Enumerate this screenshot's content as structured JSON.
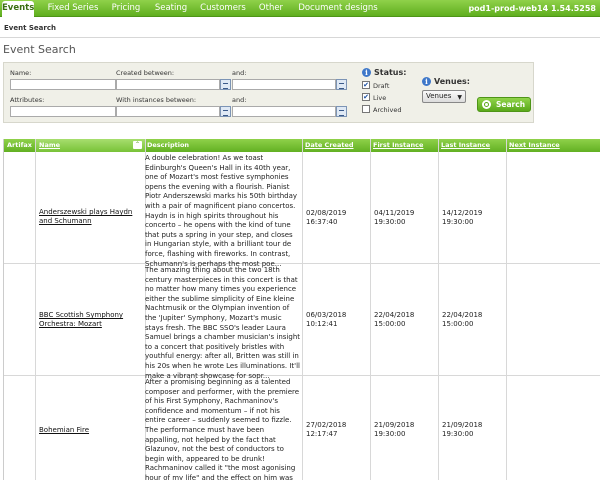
{
  "nav": {
    "tabs": [
      "Events",
      "Fixed Series",
      "Pricing",
      "Seating",
      "Customers",
      "Other",
      "Document designs"
    ],
    "active_tab": "Events",
    "server": "pod1-prod-web14 1.54.5258"
  },
  "breadcrumb": "Event Search",
  "page_title": "Event Search",
  "search": {
    "name_label": "Name:",
    "name_value": "",
    "created_between_label": "Created between:",
    "and_label": "and:",
    "created_from_value": "",
    "created_to_value": "",
    "attributes_label": "Attributes:",
    "attributes_value": "",
    "instances_between_label": "With instances between:",
    "and2_label": "and:",
    "instances_from_value": "",
    "instances_to_value": "",
    "status_label": "Status:",
    "status_options": [
      {
        "label": "Draft",
        "checked": true
      },
      {
        "label": "Live",
        "checked": true
      },
      {
        "label": "Archived",
        "checked": false
      }
    ],
    "venues_label": "Venues:",
    "venues_selected": "Venues",
    "search_button": "Search",
    "info_icon": "i"
  },
  "table": {
    "headers": {
      "artifax": "Artifax",
      "name": "Name",
      "description": "Description",
      "date_created": "Date Created",
      "first_instance": "First Instance",
      "last_instance": "Last Instance",
      "next_instance": "Next Instance"
    },
    "sort_icon": "⌃",
    "rows": [
      {
        "name": "Anderszewski plays Haydn and Schumann",
        "description": "A double celebration! As we toast Edinburgh's Queen's Hall in its 40th year, one of Mozart's most festive symphonies opens the evening with a flourish. Pianist Piotr Anderszewski marks his 50th birthday with a pair of magnificent piano concertos. Haydn is in high spirits throughout his concerto – he opens with the kind of tune that puts a spring in your step, and closes in Hungarian style, with a brilliant tour de force, flashing with fireworks. In contrast, Schumann's is perhaps the most poe...",
        "date_created": "02/08/2019\n16:37:40",
        "first_instance": "04/11/2019\n19:30:00",
        "last_instance": "14/12/2019\n19:30:00",
        "next_instance": ""
      },
      {
        "name": "BBC Scottish Symphony Orchestra: Mozart",
        "description": "The amazing thing about the two 18th century masterpieces in this concert is that no matter how many times you experience either the sublime simplicity of Eine kleine Nachtmusik or the Olympian invention of the 'Jupiter' Symphony, Mozart's music stays fresh. The BBC SSO's leader Laura Samuel brings a chamber musician's insight to a concert that positively bristles with youthful energy: after all, Britten was still in his 20s when he wrote Les illuminations. It'll make a vibrant showcase for sopr...",
        "date_created": "06/03/2018\n10:12:41",
        "first_instance": "22/04/2018\n15:00:00",
        "last_instance": "22/04/2018\n15:00:00",
        "next_instance": ""
      },
      {
        "name": "Bohemian Fire",
        "description": "After a promising beginning as a talented composer and performer, with the premiere of his First Symphony, Rachmaninov's confidence and momentum – if not his entire career – suddenly seemed to fizzle. The performance must have been appalling, not helped by the fact that Glazunov, not the best of conductors to begin with, appeared to be drunk! Rachmaninov called it \"the most agonising hour of my life\" and the effect on him was devastating. For the next three years he wrote nothing and the",
        "date_created": "27/02/2018\n12:17:47",
        "first_instance": "21/09/2018\n19:30:00",
        "last_instance": "21/09/2018\n19:30:00",
        "next_instance": ""
      }
    ]
  },
  "colors": {
    "nav_green": "#6cbf2a",
    "panel_bg": "#f0f0e8",
    "info_blue": "#3f78c9"
  }
}
